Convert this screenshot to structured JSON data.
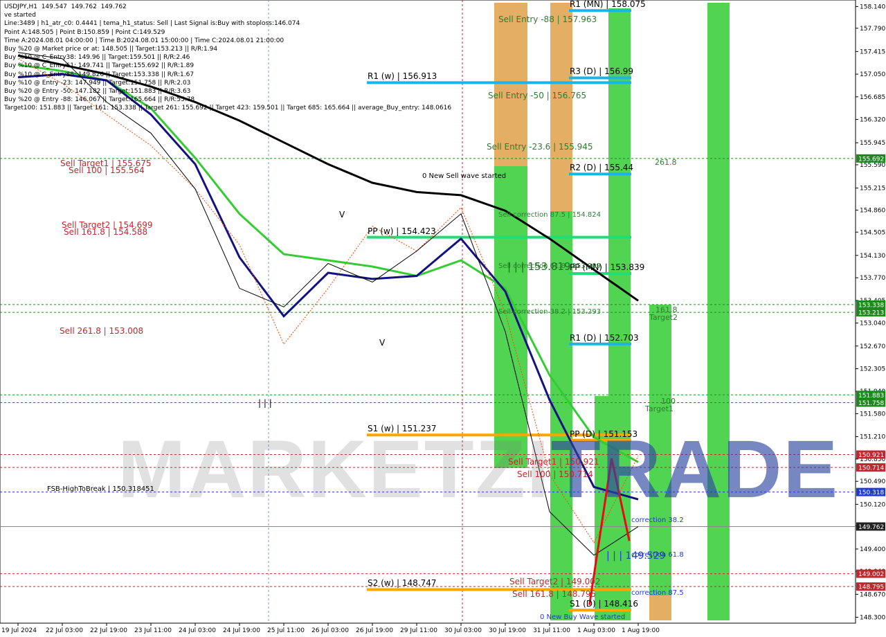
{
  "window": {
    "symbol": "USDJPY,H1",
    "info_lines": [
      "USDJPY,H1  149.547  149.762  149.762",
      "ve started",
      "Line:3489 | h1_atr_c0: 0.4441 | tema_h1_status: Sell | Last Signal is:Buy with stoploss:146.074",
      "Point A:148.505 | Point B:150.859 | Point C:149.529",
      "Time A:2024.08.01 04:00:00 | Time B:2024.08.01 15:00:00 | Time C:2024.08.01 21:00:00",
      "Buy %20 @ Market price or at: 148.505 || Target:153.213 || R/R:1.94",
      "Buy %10 @ C_Entry38: 149.96 || Target:159.501 || R/R:2.46",
      "Buy %10 @ C_Entry61: 149.741 || Target:155.692 || R/R:1.89",
      "Buy %10 @ C_Entry88: 149.826 || Target:153.338 || R/R:1.67",
      "Buy %10 @ Entry -23: 147.949 || Target:151.758 || R/R:2.03",
      "Buy %20 @ Entry -50: 147.182 || Target:151.883 || R/R:3.63",
      "Buy %20 @ Entry -88: 146.067 || Target:165.664 || R/R:55.78",
      "Target100: 151.883 || Target 161: 153.338 || Target 261: 155.692 || Target 423: 159.501 || Target 685: 165.664 || average_Buy_entry: 148.0616"
    ]
  },
  "watermark": {
    "main": "MARKETZI",
    "accent": "TRADE"
  },
  "chart_data": {
    "type": "line",
    "symbol": "USDJPY",
    "timeframe": "H1",
    "ylim": [
      148.25,
      158.2
    ],
    "x_tick_labels": [
      "19 Jul 2024",
      "22 Jul 03:00",
      "22 Jul 19:00",
      "23 Jul 11:00",
      "24 Jul 03:00",
      "24 Jul 19:00",
      "25 Jul 11:00",
      "26 Jul 03:00",
      "26 Jul 19:00",
      "29 Jul 11:00",
      "30 Jul 03:00",
      "30 Jul 19:00",
      "31 Jul 11:00",
      "1 Aug 03:00",
      "1 Aug 19:00"
    ],
    "y_tick_labels": [
      "158.140",
      "157.790",
      "157.415",
      "157.050",
      "156.685",
      "156.320",
      "155.945",
      "155.590",
      "155.215",
      "154.860",
      "154.505",
      "154.130",
      "153.770",
      "153.405",
      "153.040",
      "152.670",
      "152.305",
      "151.940",
      "151.580",
      "151.210",
      "150.850",
      "150.490",
      "150.120",
      "149.770",
      "149.400",
      "149.040",
      "148.670",
      "148.300"
    ],
    "price_labels": [
      {
        "text": "155.692",
        "value": 155.692,
        "color": "#1e8a1e"
      },
      {
        "text": "153.338",
        "value": 153.338,
        "color": "#1e8a1e"
      },
      {
        "text": "153.213",
        "value": 153.213,
        "color": "#1e8a1e"
      },
      {
        "text": "151.883",
        "value": 151.883,
        "color": "#1e8a1e"
      },
      {
        "text": "151.758",
        "value": 151.758,
        "color": "#1e8a1e"
      },
      {
        "text": "150.921",
        "value": 150.921,
        "color": "#c0282d"
      },
      {
        "text": "150.714",
        "value": 150.714,
        "color": "#c0282d"
      },
      {
        "text": "150.318",
        "value": 150.318,
        "color": "#1e3cc8"
      },
      {
        "text": "149.762",
        "value": 149.762,
        "color": "#222222"
      },
      {
        "text": "149.002",
        "value": 149.002,
        "color": "#c0282d"
      },
      {
        "text": "148.795",
        "value": 148.795,
        "color": "#c0282d"
      }
    ],
    "pivot_levels": [
      {
        "text": "R1 (w) | 156.913",
        "value": 156.913,
        "color": "#1ab4e6",
        "x0": 530,
        "x1": 912
      },
      {
        "text": "PP (w) | 154.423",
        "value": 154.423,
        "color": "#22dd77",
        "x0": 530,
        "x1": 912
      },
      {
        "text": "S1 (w) | 151.237",
        "value": 151.237,
        "color": "#ffa500",
        "x0": 530,
        "x1": 912
      },
      {
        "text": "S2 (w) | 148.747",
        "value": 148.747,
        "color": "#ffa500",
        "x0": 530,
        "x1": 912
      },
      {
        "text": "R3 (D) | 156.99",
        "value": 156.99,
        "color": "#1ab4e6",
        "x0": 822,
        "x1": 912
      },
      {
        "text": "R2 (D) | 155.44",
        "value": 155.44,
        "color": "#1ab4e6",
        "x0": 822,
        "x1": 912
      },
      {
        "text": "PP (MN) | 153.839",
        "value": 153.839,
        "color": "#22dd77",
        "x0": 822,
        "x1": 912
      },
      {
        "text": "R1 (D) | 152.703",
        "value": 152.703,
        "color": "#1ab4e6",
        "x0": 822,
        "x1": 912
      },
      {
        "text": "PP (D) | 151.153",
        "value": 151.153,
        "color": "#ffa500",
        "x0": 822,
        "x1": 912
      },
      {
        "text": "S1 (D) | 148.416",
        "value": 148.416,
        "color": "#ffa500",
        "x0": 822,
        "x1": 912
      },
      {
        "text": "R1 (MN) | 158.075",
        "value": 158.075,
        "color": "#1ab4e6",
        "x0": 822,
        "x1": 912
      }
    ],
    "dashed_levels": [
      {
        "value": 155.692,
        "color": "#1e8a1e"
      },
      {
        "value": 153.338,
        "color": "#1e8a1e"
      },
      {
        "value": 153.213,
        "color": "#1e8a1e"
      },
      {
        "value": 151.883,
        "color": "#1e8a1e"
      },
      {
        "value": 151.758,
        "color": "#1e8a1e"
      },
      {
        "value": 150.921,
        "color": "#c0282d"
      },
      {
        "value": 150.714,
        "color": "#c0282d"
      },
      {
        "value": 150.318,
        "color": "#2233cc"
      },
      {
        "value": 149.002,
        "color": "#c0282d"
      },
      {
        "value": 148.795,
        "color": "#c0282d"
      }
    ],
    "annotations": [
      {
        "text": "Sell Target1 | 155.675",
        "color": "#c0282d"
      },
      {
        "text": "Sell 100 | 155.564",
        "color": "#c0282d"
      },
      {
        "text": "Sell Target2 | 154.699",
        "color": "#c0282d"
      },
      {
        "text": "Sell 161.8 | 154.588",
        "color": "#c0282d"
      },
      {
        "text": "Sell  261.8 | 153.008",
        "color": "#c0282d"
      },
      {
        "text": "Sell Entry -88 | 157.963",
        "color": "#2e7d32"
      },
      {
        "text": "Sell Entry -50 | 156.765",
        "color": "#2e7d32"
      },
      {
        "text": "Sell Entry -23.6 | 155.945",
        "color": "#2e7d32"
      },
      {
        "text": "0 New Sell wave started",
        "color": "#000000"
      },
      {
        "text": "Sell correction 87.5 | 154.824",
        "color": "#2e7d32"
      },
      {
        "text": "Sell correction 61.8 | 153.909",
        "color": "#2e7d32"
      },
      {
        "text": "| | | 153.819",
        "color": "#1e6f1e"
      },
      {
        "text": "Sell correction 38.2 | 153.293",
        "color": "#2e7d32"
      },
      {
        "text": "261.8",
        "color": "#2e7d32"
      },
      {
        "text": "161.8",
        "color": "#2e7d32"
      },
      {
        "text": "Target2",
        "color": "#2e7d32"
      },
      {
        "text": "100",
        "color": "#2e7d32"
      },
      {
        "text": "Target1",
        "color": "#2e7d32"
      },
      {
        "text": "Sell Target1 | 150.921",
        "color": "#c0282d"
      },
      {
        "text": "Sell 100 | 150.714",
        "color": "#c0282d"
      },
      {
        "text": "correction 38.2",
        "color": "#1e3cc8"
      },
      {
        "text": "| | | 149.529",
        "color": "#1e3cc8"
      },
      {
        "text": "correction 61.8",
        "color": "#1e3cc8"
      },
      {
        "text": "Sell Target2 | 149.002",
        "color": "#c0282d"
      },
      {
        "text": "Sell 161.8 | 148.795",
        "color": "#c0282d"
      },
      {
        "text": "correction 87.5",
        "color": "#1e3cc8"
      },
      {
        "text": "0 New Buy Wave started",
        "color": "#1e3cc8"
      },
      {
        "text": "FSB-HighToBreak | 150.318451",
        "color": "#000000"
      },
      {
        "text": "V",
        "color": "#000000"
      },
      {
        "text": "V",
        "color": "#000000"
      },
      {
        "text": "| | |",
        "color": "#000000"
      }
    ],
    "series": [
      {
        "name": "",
        "color": "#000000",
        "x": [
          "19 Jul 2024",
          "22 Jul 03:00",
          "22 Jul 19:00",
          "23 Jul 11:00",
          "24 Jul 03:00",
          "24 Jul 19:00",
          "25 Jul 11:00",
          "26 Jul 03:00",
          "26 Jul 19:00",
          "29 Jul 11:00",
          "30 Jul 03:00",
          "30 Jul 19:00",
          "31 Jul 11:00",
          "1 Aug 03:00",
          "1 Aug 19:00"
        ],
        "values": [
          157.35,
          157.2,
          157.05,
          156.85,
          156.6,
          156.3,
          155.95,
          155.6,
          155.3,
          155.15,
          155.1,
          154.85,
          154.4,
          153.9,
          153.4
        ]
      },
      {
        "name": "",
        "color": "#33cc33",
        "x": [
          "19 Jul 2024",
          "22 Jul 03:00",
          "22 Jul 19:00",
          "23 Jul 11:00",
          "24 Jul 03:00",
          "24 Jul 19:00",
          "25 Jul 11:00",
          "26 Jul 03:00",
          "26 Jul 19:00",
          "29 Jul 11:00",
          "30 Jul 03:00",
          "30 Jul 19:00",
          "31 Jul 11:00",
          "1 Aug 03:00",
          "1 Aug 19:00"
        ],
        "values": [
          157.2,
          157.1,
          156.95,
          156.5,
          155.7,
          154.8,
          154.15,
          154.05,
          153.95,
          153.8,
          154.05,
          153.6,
          152.2,
          151.2,
          150.8
        ]
      },
      {
        "name": "",
        "color": "#121280",
        "x": [
          "19 Jul 2024",
          "22 Jul 03:00",
          "22 Jul 19:00",
          "23 Jul 11:00",
          "24 Jul 03:00",
          "24 Jul 19:00",
          "25 Jul 11:00",
          "26 Jul 03:00",
          "26 Jul 19:00",
          "29 Jul 11:00",
          "30 Jul 03:00",
          "30 Jul 19:00",
          "31 Jul 11:00",
          "1 Aug 03:00",
          "1 Aug 19:00"
        ],
        "values": [
          157.0,
          157.05,
          156.95,
          156.4,
          155.6,
          154.1,
          153.15,
          153.85,
          153.75,
          153.8,
          154.4,
          153.55,
          151.8,
          150.4,
          150.2
        ]
      },
      {
        "name": "",
        "color": "#ff4400",
        "x": [
          "19 Jul 2024",
          "22 Jul 03:00",
          "22 Jul 19:00",
          "23 Jul 11:00",
          "24 Jul 03:00",
          "24 Jul 19:00",
          "25 Jul 11:00",
          "26 Jul 03:00",
          "26 Jul 19:00",
          "29 Jul 11:00",
          "30 Jul 03:00",
          "30 Jul 19:00",
          "31 Jul 11:00",
          "1 Aug 03:00",
          "1 Aug 19:00"
        ],
        "values": [
          157.3,
          156.9,
          156.4,
          155.9,
          155.2,
          154.3,
          152.7,
          153.6,
          154.6,
          154.2,
          154.9,
          153.2,
          150.6,
          149.5,
          150.9
        ]
      },
      {
        "name": "",
        "color": "#000000",
        "x": [
          "19 Jul 2024",
          "22 Jul 03:00",
          "22 Jul 19:00",
          "23 Jul 11:00",
          "24 Jul 03:00",
          "24 Jul 19:00",
          "25 Jul 11:00",
          "26 Jul 03:00",
          "26 Jul 19:00",
          "29 Jul 11:00",
          "30 Jul 03:00",
          "30 Jul 19:00",
          "31 Jul 11:00",
          "1 Aug 03:00",
          "1 Aug 19:00"
        ],
        "values": [
          157.4,
          157.3,
          156.6,
          156.1,
          155.2,
          153.6,
          153.3,
          154.0,
          153.7,
          154.2,
          154.8,
          152.9,
          150.0,
          149.3,
          149.76
        ]
      }
    ],
    "last_price": 149.762,
    "grid": false
  }
}
